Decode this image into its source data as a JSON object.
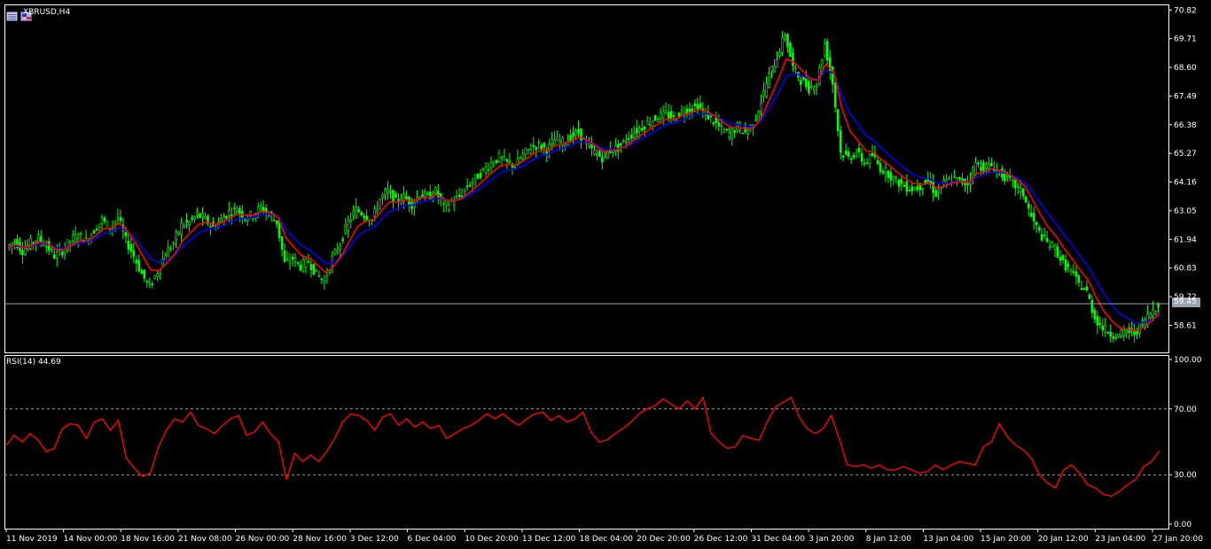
{
  "window": {
    "title": "XBRUSD,H4",
    "symbol_icons": [
      "window-list-icon",
      "flag-icon"
    ]
  },
  "current_price": "59.45",
  "colors": {
    "background": "#000000",
    "frame": "#ffffff",
    "bull_candle": "#00ff00",
    "bear_candle": "#00ff00",
    "ma_fast": "#ff0000",
    "ma_slow": "#0000ff",
    "rsi_line": "#ff0000",
    "bid_line": "#9aa4b0",
    "level_lines": "#a0a0a0"
  },
  "chart_data": [
    {
      "type": "line",
      "title": "XBRUSD,H4",
      "xlabel": "",
      "ylabel": "",
      "grid": false,
      "ylim": [
        57.7,
        70.9
      ],
      "x_ticks": [
        "11 Nov 2019",
        "14 Nov 00:00",
        "18 Nov 16:00",
        "21 Nov 08:00",
        "26 Nov 00:00",
        "28 Nov 16:00",
        "3 Dec 12:00",
        "6 Dec 04:00",
        "10 Dec 20:00",
        "13 Dec 12:00",
        "18 Dec 04:00",
        "20 Dec 20:00",
        "26 Dec 12:00",
        "31 Dec 04:00",
        "3 Jan 20:00",
        "8 Jan 12:00",
        "13 Jan 04:00",
        "15 Jan 20:00",
        "20 Jan 12:00",
        "23 Jan 04:00",
        "27 Jan 20:00"
      ],
      "y_ticks": [
        "70.82",
        "69.71",
        "68.60",
        "67.49",
        "66.38",
        "65.27",
        "64.16",
        "63.05",
        "61.94",
        "60.83",
        "59.72",
        "58.61"
      ],
      "series": [
        {
          "kind": "close",
          "values": [
            61.6,
            61.9,
            61.5,
            61.8,
            62.0,
            61.7,
            61.3,
            61.5,
            61.9,
            62.1,
            61.9,
            62.3,
            62.7,
            62.4,
            62.8,
            61.9,
            61.3,
            60.6,
            60.1,
            60.7,
            61.4,
            61.8,
            62.5,
            62.6,
            62.9,
            62.7,
            62.4,
            62.7,
            63.0,
            63.1,
            62.8,
            62.9,
            63.2,
            62.9,
            62.6,
            61.0,
            61.2,
            60.9,
            61.1,
            60.6,
            60.3,
            61.2,
            61.8,
            62.6,
            63.1,
            62.9,
            62.7,
            63.5,
            63.8,
            63.4,
            63.6,
            63.3,
            63.7,
            63.6,
            63.8,
            63.2,
            63.4,
            63.6,
            64.0,
            64.3,
            64.6,
            64.9,
            65.1,
            64.9,
            64.8,
            65.2,
            65.5,
            65.6,
            65.4,
            65.8,
            65.7,
            65.9,
            66.1,
            65.6,
            65.3,
            65.1,
            65.4,
            65.5,
            65.8,
            66.1,
            66.3,
            66.5,
            66.7,
            66.8,
            66.6,
            66.9,
            67.0,
            67.1,
            66.8,
            66.5,
            66.2,
            66.0,
            66.3,
            66.1,
            66.4,
            67.3,
            68.3,
            69.0,
            69.9,
            68.6,
            68.1,
            67.8,
            68.0,
            69.5,
            68.0,
            65.3,
            65.1,
            65.3,
            64.9,
            65.2,
            64.7,
            64.5,
            64.2,
            64.0,
            63.9,
            64.0,
            64.2,
            63.7,
            64.1,
            64.3,
            64.2,
            64.1,
            64.9,
            64.7,
            64.8,
            64.5,
            64.3,
            64.0,
            63.7,
            62.8,
            62.2,
            61.8,
            61.6,
            61.0,
            60.7,
            60.2,
            59.9,
            58.9,
            58.5,
            58.3,
            58.2,
            58.4,
            58.3,
            58.7,
            59.1,
            59.45
          ]
        },
        {
          "name": "",
          "kind": "ma_fast",
          "color": "#ff0000"
        },
        {
          "name": "",
          "kind": "ma_slow",
          "color": "#0000ff"
        }
      ]
    },
    {
      "type": "line",
      "title": "RSI(14) 44.69",
      "xlabel": "",
      "ylabel": "",
      "ylim": [
        0,
        100
      ],
      "y_ticks": [
        "100.00",
        "70.00",
        "30.00",
        "0.00"
      ],
      "levels": [
        70,
        30
      ],
      "series": [
        {
          "name": "RSI(14)",
          "values": [
            48,
            54,
            50,
            55,
            51,
            44,
            46,
            58,
            61,
            60,
            52,
            62,
            64,
            57,
            63,
            40,
            34,
            29,
            31,
            47,
            57,
            64,
            62,
            68,
            60,
            58,
            55,
            60,
            64,
            66,
            54,
            56,
            62,
            55,
            50,
            27,
            43,
            38,
            42,
            38,
            44,
            52,
            62,
            67,
            66,
            63,
            57,
            65,
            67,
            60,
            64,
            59,
            62,
            58,
            60,
            52,
            55,
            58,
            60,
            63,
            67,
            64,
            67,
            63,
            60,
            64,
            67,
            68,
            63,
            66,
            62,
            64,
            68,
            56,
            50,
            51,
            55,
            58,
            62,
            67,
            70,
            72,
            76,
            73,
            70,
            75,
            70,
            77,
            55,
            50,
            46,
            47,
            54,
            52,
            51,
            62,
            71,
            74,
            77,
            65,
            58,
            55,
            58,
            66,
            52,
            36,
            35,
            36,
            34,
            36,
            33,
            33,
            35,
            33,
            31,
            32,
            36,
            33,
            36,
            38,
            37,
            36,
            47,
            50,
            61,
            53,
            48,
            45,
            40,
            30,
            25,
            22,
            33,
            36,
            31,
            24,
            22,
            18,
            17,
            20,
            24,
            27,
            35,
            38,
            44.69
          ]
        }
      ]
    }
  ]
}
